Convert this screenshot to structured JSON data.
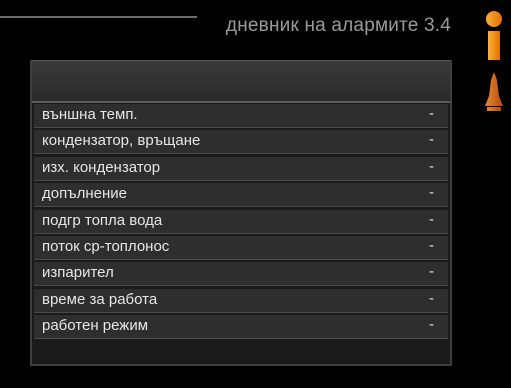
{
  "header": {
    "title": "дневник на алармите 3.4"
  },
  "status_icons": {
    "info_icon": "info-icon",
    "alarm_icon": "alarm-bell-icon",
    "accent_color": "#f08a10"
  },
  "panel": {
    "header_text": "",
    "rows": [
      {
        "label": "външна темп.",
        "value": "-"
      },
      {
        "label": "кондензатор, връщане",
        "value": "-"
      },
      {
        "label": "изх. кондензатор",
        "value": "-"
      },
      {
        "label": "допълнение",
        "value": "-"
      },
      {
        "label": "подгр топла вода",
        "value": "-"
      },
      {
        "label": "поток ср-топлонос",
        "value": "-"
      },
      {
        "label": "изпарител",
        "value": "-"
      },
      {
        "label": "време за работа",
        "value": "-"
      },
      {
        "label": "работен режим",
        "value": "-"
      }
    ]
  }
}
